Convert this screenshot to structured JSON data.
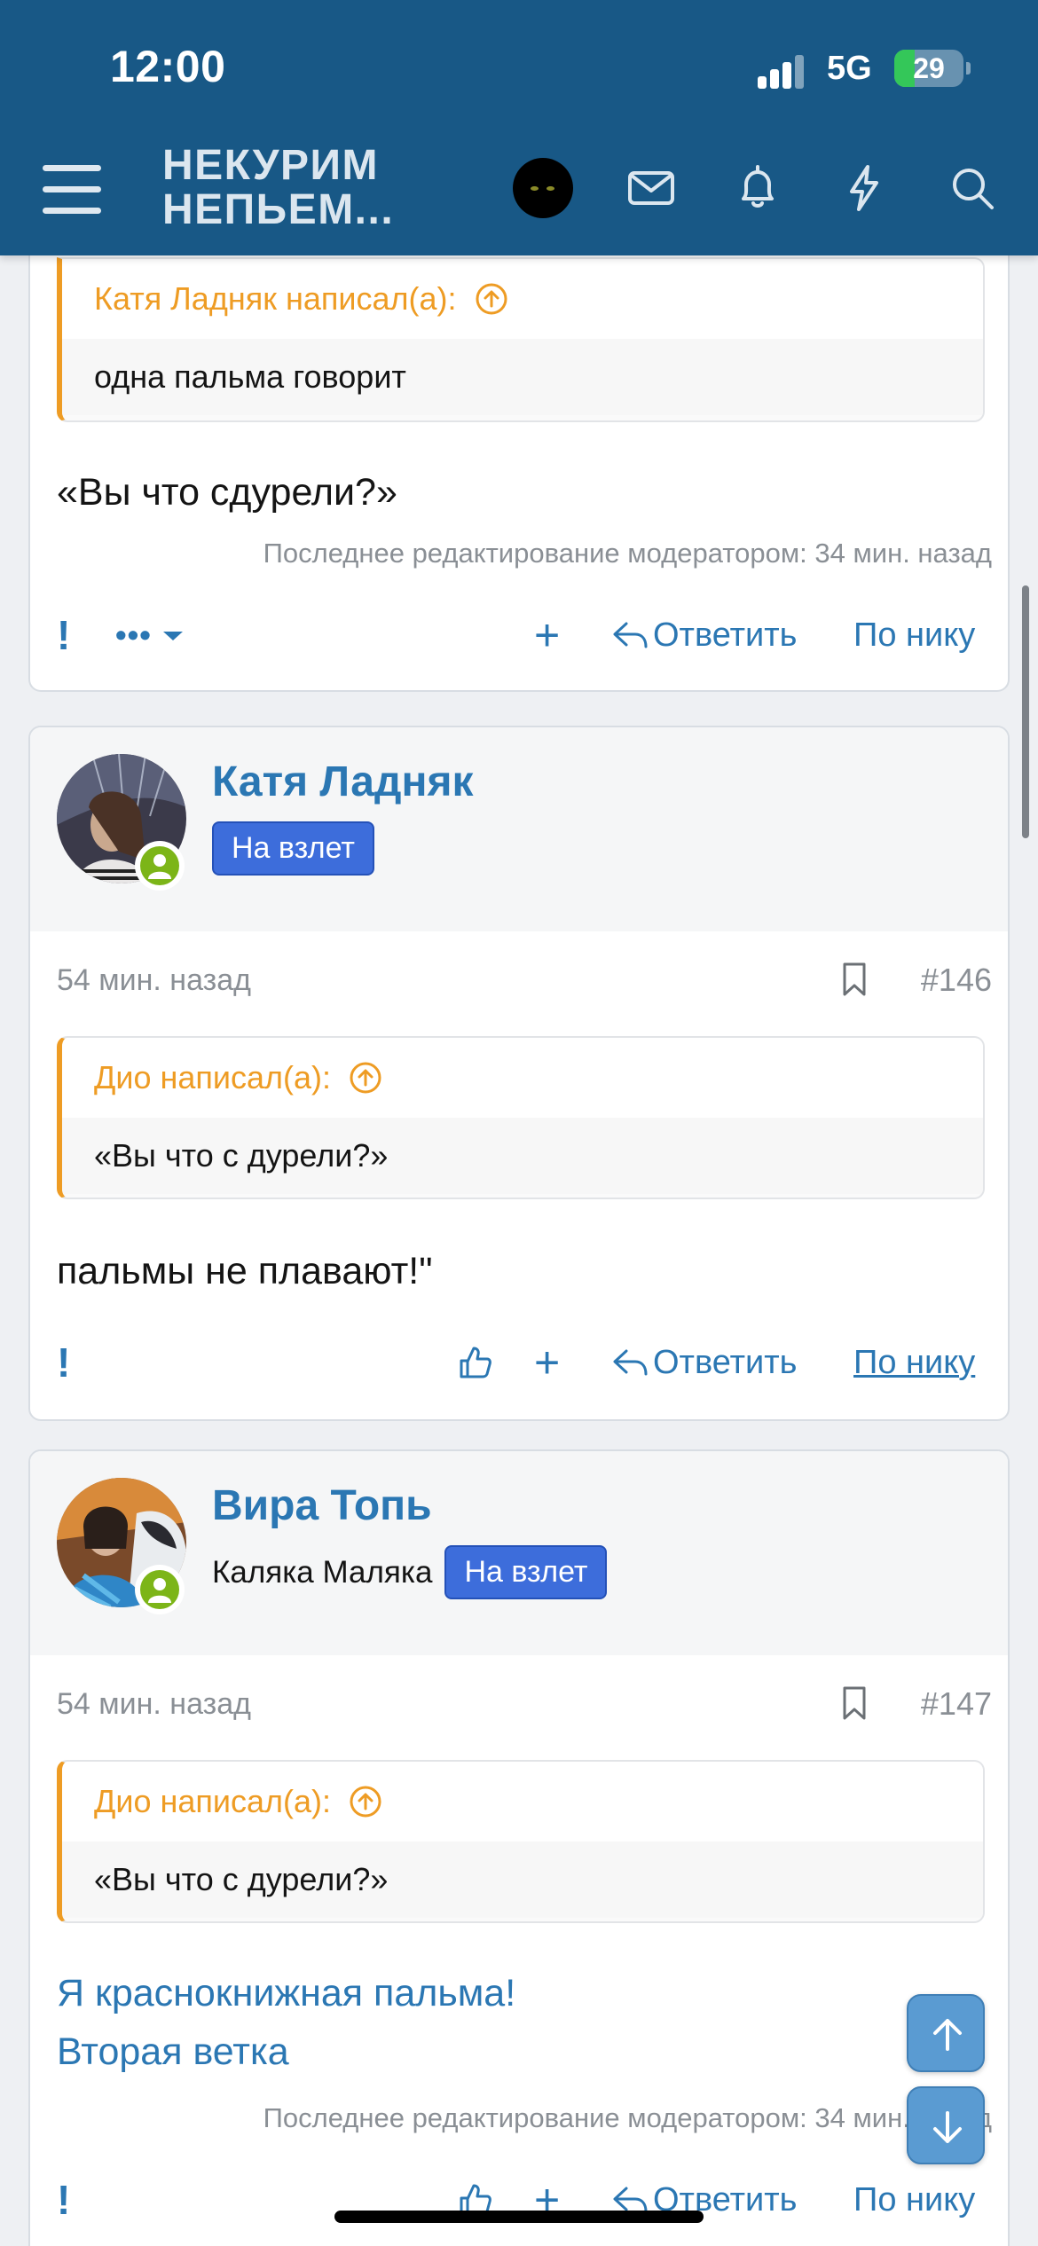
{
  "status": {
    "time": "12:00",
    "network": "5G",
    "battery": "29",
    "battery_level": 0.29
  },
  "header": {
    "logo_line1": "НЕКУРИМ",
    "logo_line2": "НЕПЬЕМ..."
  },
  "posts": [
    {
      "quote_author": "Катя Ладняк написал(а):",
      "quote_text": "одна пальма говорит",
      "message": "«Вы что сдурели?»",
      "edited": "Последнее редактирование модератором: 34 мин. назад",
      "actions": {
        "report": "!",
        "more": "•••",
        "plus": "+",
        "reply": "Ответить",
        "by_nick": "По нику"
      }
    },
    {
      "username": "Катя Ладняк",
      "badge": "На взлет",
      "time": "54 мин. назад",
      "number": "#146",
      "quote_author": "Дио написал(а):",
      "quote_text": "«Вы что с дурели?»",
      "message": "пальмы не плавают!\"",
      "actions": {
        "report": "!",
        "plus": "+",
        "reply": "Ответить",
        "by_nick": "По нику"
      }
    },
    {
      "username": "Вира Топь",
      "user_title": "Каляка Маляка",
      "badge": "На взлет",
      "time": "54 мин. назад",
      "number": "#147",
      "quote_author": "Дио написал(а):",
      "quote_text": "«Вы что с дурели?»",
      "message_line1": "Я краснокнижная пальма!",
      "message_line2": "Вторая ветка",
      "edited": "Последнее редактирование модератором: 34 мин. назад",
      "actions": {
        "report": "!",
        "plus": "+",
        "reply": "Ответить",
        "by_nick": "По нику"
      }
    }
  ],
  "colors": {
    "header": "#185886",
    "link": "#2b77b3",
    "quote_accent": "#ee9c24",
    "badge": "#3d6ddb",
    "online": "#7cb518"
  }
}
